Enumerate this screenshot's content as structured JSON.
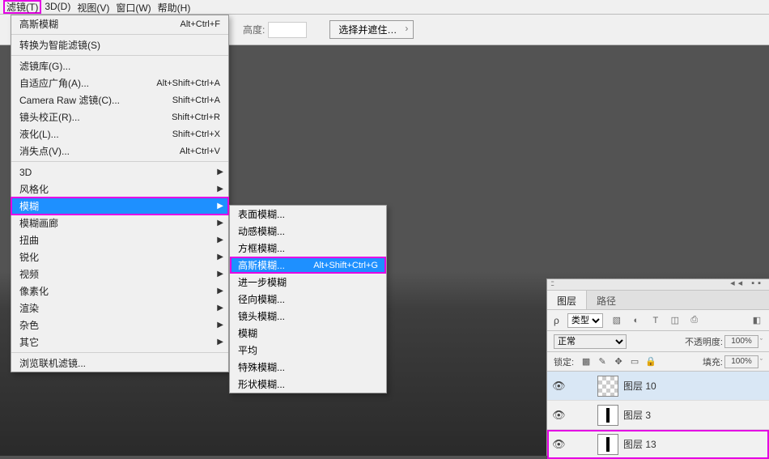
{
  "menubar": {
    "items": [
      "滤镜(T)",
      "3D(D)",
      "视图(V)",
      "窗口(W)",
      "帮助(H)"
    ]
  },
  "optionbar": {
    "height_label": "高度:",
    "select_mask": "选择并遮住…"
  },
  "filter_menu": [
    {
      "label": "高斯模糊",
      "shortcut": "Alt+Ctrl+F"
    },
    {
      "sep": true
    },
    {
      "label": "转换为智能滤镜(S)"
    },
    {
      "sep": true
    },
    {
      "label": "滤镜库(G)..."
    },
    {
      "label": "自适应广角(A)...",
      "shortcut": "Alt+Shift+Ctrl+A"
    },
    {
      "label": "Camera Raw 滤镜(C)...",
      "shortcut": "Shift+Ctrl+A"
    },
    {
      "label": "镜头校正(R)...",
      "shortcut": "Shift+Ctrl+R"
    },
    {
      "label": "液化(L)...",
      "shortcut": "Shift+Ctrl+X"
    },
    {
      "label": "消失点(V)...",
      "shortcut": "Alt+Ctrl+V"
    },
    {
      "sep": true
    },
    {
      "label": "3D",
      "arrow": true
    },
    {
      "label": "风格化",
      "arrow": true
    },
    {
      "label": "模糊",
      "arrow": true,
      "selected": true,
      "highlight": true
    },
    {
      "label": "模糊画廊",
      "arrow": true
    },
    {
      "label": "扭曲",
      "arrow": true
    },
    {
      "label": "锐化",
      "arrow": true
    },
    {
      "label": "视频",
      "arrow": true
    },
    {
      "label": "像素化",
      "arrow": true
    },
    {
      "label": "渲染",
      "arrow": true
    },
    {
      "label": "杂色",
      "arrow": true
    },
    {
      "label": "其它",
      "arrow": true
    },
    {
      "sep": true
    },
    {
      "label": "浏览联机滤镜..."
    }
  ],
  "blur_submenu": [
    {
      "label": "表面模糊..."
    },
    {
      "label": "动感模糊..."
    },
    {
      "label": "方框模糊..."
    },
    {
      "label": "高斯模糊...",
      "shortcut": "Alt+Shift+Ctrl+G",
      "selected": true,
      "highlight": true
    },
    {
      "label": "进一步模糊"
    },
    {
      "label": "径向模糊..."
    },
    {
      "label": "镜头模糊..."
    },
    {
      "label": "模糊"
    },
    {
      "label": "平均"
    },
    {
      "label": "特殊模糊..."
    },
    {
      "label": "形状模糊..."
    }
  ],
  "layers_panel": {
    "tabs": {
      "layers": "图层",
      "paths": "路径"
    },
    "filter": {
      "kind_prefix": "ρ",
      "kind": "类型"
    },
    "blend": {
      "mode": "正常",
      "opacity_label": "不透明度:",
      "opacity": "100%"
    },
    "lock": {
      "label": "锁定:",
      "fill_label": "填充:",
      "fill": "100%"
    },
    "layers": [
      {
        "name": "图层 10",
        "thumb": "checker"
      },
      {
        "name": "图层 3",
        "thumb": "white"
      },
      {
        "name": "图层 13",
        "thumb": "white",
        "highlight": true
      }
    ]
  }
}
